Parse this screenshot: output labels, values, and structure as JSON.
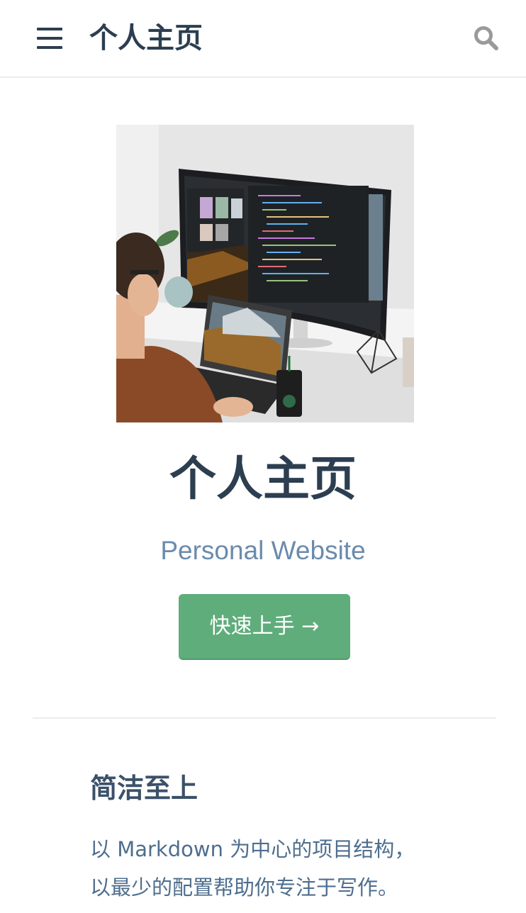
{
  "navbar": {
    "menu_icon": "hamburger-menu-icon",
    "site_title": "个人主页",
    "search_icon": "magnifier-search-icon"
  },
  "hero": {
    "image_alt": "developer working at desk with ultrawide monitor and laptop",
    "title": "个人主页",
    "description": "Personal Website",
    "action_label": "快速上手 →"
  },
  "features": [
    {
      "title": "简洁至上",
      "lines": [
        "以 Markdown 为中心的项目结构，",
        "以最少的配置帮助你专注于写作。"
      ]
    }
  ],
  "colors": {
    "accent": "#5fad7b",
    "title": "#2c3e50",
    "subtitle": "#6a8bad",
    "border": "#eaecef"
  }
}
